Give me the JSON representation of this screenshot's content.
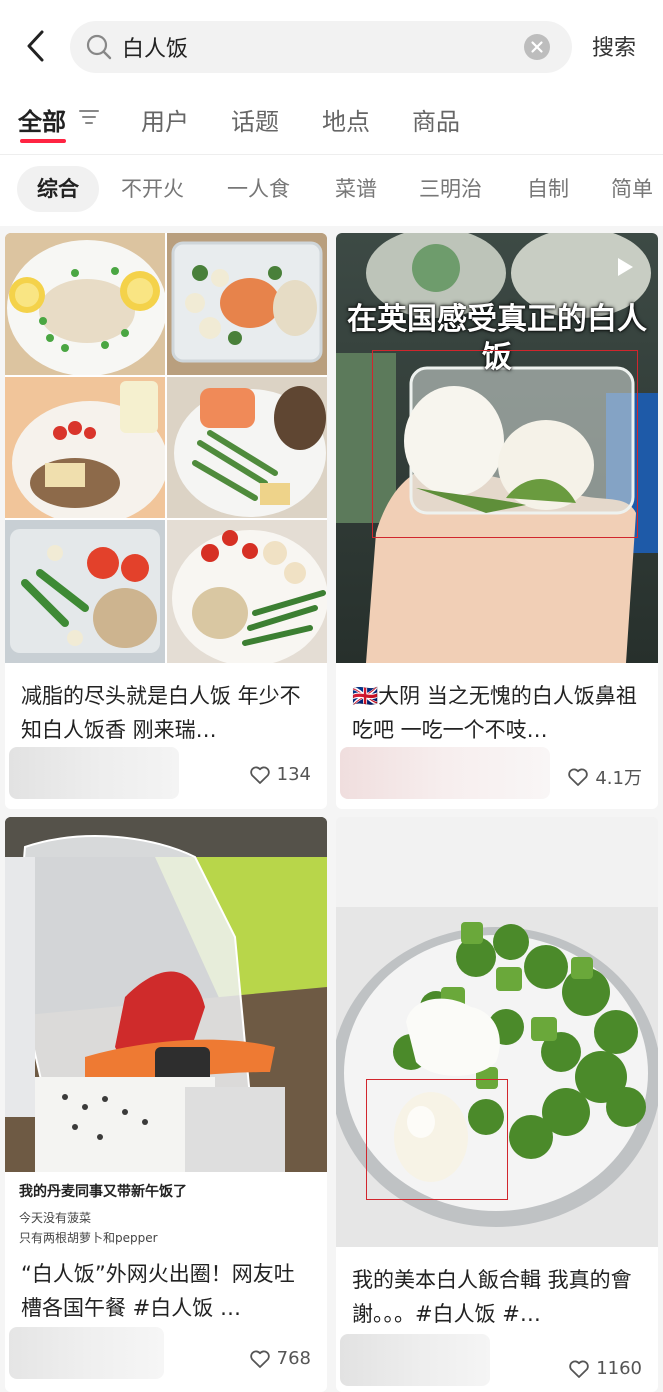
{
  "search": {
    "query": "白人饭",
    "button_label": "搜索"
  },
  "tabs": [
    {
      "label": "全部",
      "active": true
    },
    {
      "label": "用户"
    },
    {
      "label": "话题"
    },
    {
      "label": "地点"
    },
    {
      "label": "商品"
    }
  ],
  "chips": [
    {
      "label": "综合",
      "active": true
    },
    {
      "label": "不开火"
    },
    {
      "label": "一人食"
    },
    {
      "label": "菜谱"
    },
    {
      "label": "三明治"
    },
    {
      "label": "自制"
    },
    {
      "label": "简单"
    }
  ],
  "posts": [
    {
      "title": "减脂的尽头就是白人饭 年少不知白人饭香 刚来瑞…",
      "likes": "134"
    },
    {
      "title": "🇬🇧大阴 当之无愧的白人饭鼻祖 吃吧 一吃一个不吱…",
      "likes": "4.1万",
      "overlay_title": "在英国感受真正的白人饭"
    },
    {
      "title": "“白人饭”外网火出圈！网友吐槽各国午餐 #白人饭 …",
      "likes": "768",
      "caption_title": "我的丹麦同事又带新午饭了",
      "caption_line1": "今天没有菠菜",
      "caption_line2": "只有两根胡萝卜和pepper"
    },
    {
      "title": "我的美本白人飯合輯 我真的會謝。。。#白人饭 #…",
      "likes": "1160"
    }
  ]
}
